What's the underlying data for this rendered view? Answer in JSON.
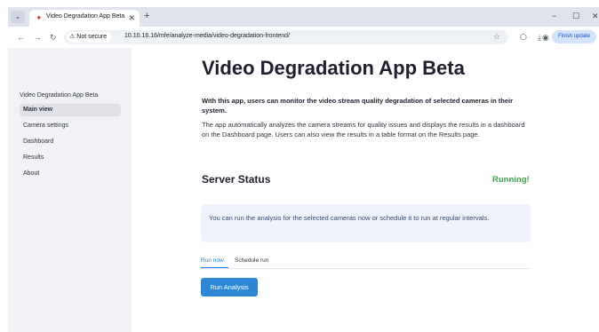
{
  "browser": {
    "tab_search_glyph": "⌄",
    "tab": {
      "favicon_glyph": "✦",
      "title": "Video Degradation App Beta",
      "close_glyph": "✕"
    },
    "new_tab_glyph": "+",
    "window_controls": {
      "minimize": "−",
      "maximize": "☐",
      "close": "✕"
    },
    "nav": {
      "back": "←",
      "forward": "→",
      "reload": "↻"
    },
    "security_warning_glyph": "⚠",
    "security_label": "Not secure",
    "url": "10.10.16.16/mfe/analyze-media/video-degradation-frontend/",
    "bookmark_glyph": "☆",
    "toolbar_icons": {
      "extensions": "⎔",
      "download": "⤓",
      "profile": "◉",
      "menu": "⋮"
    },
    "finish_update_label": "Finish update"
  },
  "sidebar": {
    "title": "Video Degradation App Beta",
    "items": [
      {
        "label": "Main view",
        "active": true
      },
      {
        "label": "Camera settings",
        "active": false
      },
      {
        "label": "Dashboard",
        "active": false
      },
      {
        "label": "Results",
        "active": false
      },
      {
        "label": "About",
        "active": false
      }
    ]
  },
  "main": {
    "title": "Video Degradation App Beta",
    "intro_bold": "With this app, users can monitor the video stream quality degradation of selected cameras in their system.",
    "intro": "The app automatically analyzes the camera streams for quality issues and displays the results in a dashboard on the Dashboard page. Users can also view the results in a table format on the Results page.",
    "server_status_heading": "Server Status",
    "server_status_value": "Running!",
    "info_text": "You can run the analysis for the selected cameras now or schedule it to run at regular intervals.",
    "tabs": [
      {
        "label": "Run now",
        "active": true
      },
      {
        "label": "Schedule run",
        "active": false
      }
    ],
    "run_button_label": "Run Analysis"
  },
  "colors": {
    "status_running": "#3aa64b",
    "primary_button": "#2e87d5",
    "active_tab": "#1c83e1",
    "sidebar_bg": "#f0f2f6",
    "info_box_bg": "#eef2fb"
  }
}
